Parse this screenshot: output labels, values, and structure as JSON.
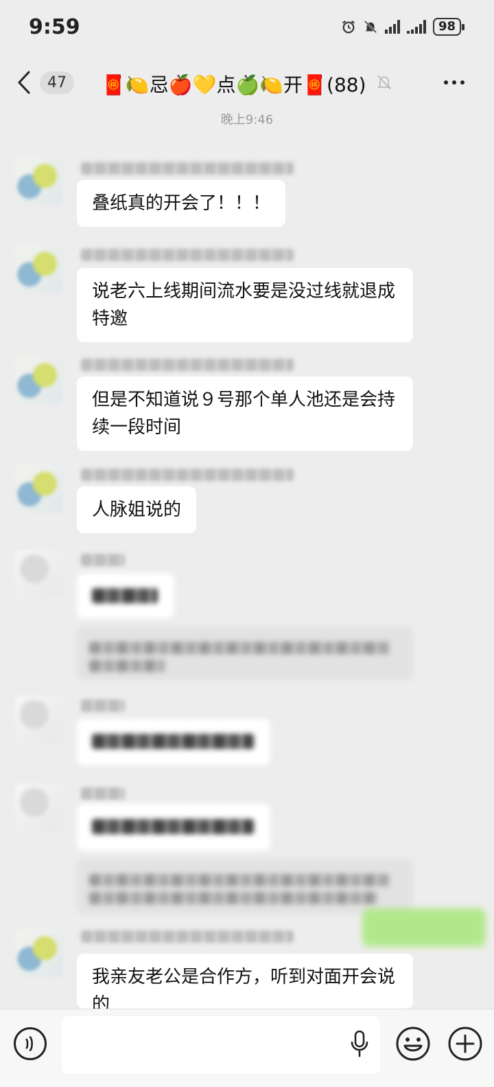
{
  "status": {
    "time": "9:59",
    "battery": "98"
  },
  "header": {
    "unread_count": "47",
    "title": "🧧🍋忌🍎💛点🍏🍋开🧧(88)",
    "icons": [
      "back-chevron-icon",
      "mute-bell-icon",
      "more-dots-icon"
    ]
  },
  "timestamp": "晚上9:46",
  "messages": [
    {
      "text": "叠纸真的开会了！！！"
    },
    {
      "text": "说老六上线期间流水要是没过线就退成特邀"
    },
    {
      "text": "但是不知道说９号那个单人池还是会持续一段时间"
    },
    {
      "text": "人脉姐说的"
    },
    {
      "text": "我亲友老公是合作方，听到对面开会说的"
    }
  ],
  "input_bar": {
    "icons": [
      "voice-icon",
      "mic-icon",
      "emoji-icon",
      "plus-icon"
    ]
  }
}
